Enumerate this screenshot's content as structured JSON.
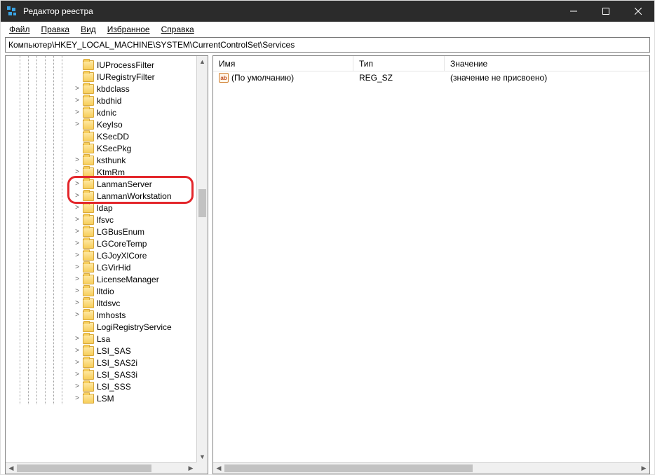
{
  "window": {
    "title": "Редактор реестра"
  },
  "menu": {
    "file": "Файл",
    "edit": "Правка",
    "view": "Вид",
    "favorites": "Избранное",
    "help": "Справка"
  },
  "addressbar": {
    "path": "Компьютер\\HKEY_LOCAL_MACHINE\\SYSTEM\\CurrentControlSet\\Services"
  },
  "tree": {
    "items": [
      {
        "label": "IUProcessFilter",
        "expander": ""
      },
      {
        "label": "IURegistryFilter",
        "expander": ""
      },
      {
        "label": "kbdclass",
        "expander": ">"
      },
      {
        "label": "kbdhid",
        "expander": ">"
      },
      {
        "label": "kdnic",
        "expander": ">"
      },
      {
        "label": "KeyIso",
        "expander": ">"
      },
      {
        "label": "KSecDD",
        "expander": ""
      },
      {
        "label": "KSecPkg",
        "expander": ""
      },
      {
        "label": "ksthunk",
        "expander": ">"
      },
      {
        "label": "KtmRm",
        "expander": ">"
      },
      {
        "label": "LanmanServer",
        "expander": ">"
      },
      {
        "label": "LanmanWorkstation",
        "expander": ">"
      },
      {
        "label": "ldap",
        "expander": ">"
      },
      {
        "label": "lfsvc",
        "expander": ">"
      },
      {
        "label": "LGBusEnum",
        "expander": ">"
      },
      {
        "label": "LGCoreTemp",
        "expander": ">"
      },
      {
        "label": "LGJoyXlCore",
        "expander": ">"
      },
      {
        "label": "LGVirHid",
        "expander": ">"
      },
      {
        "label": "LicenseManager",
        "expander": ">"
      },
      {
        "label": "lltdio",
        "expander": ">"
      },
      {
        "label": "lltdsvc",
        "expander": ">"
      },
      {
        "label": "lmhosts",
        "expander": ">"
      },
      {
        "label": "LogiRegistryService",
        "expander": ""
      },
      {
        "label": "Lsa",
        "expander": ">"
      },
      {
        "label": "LSI_SAS",
        "expander": ">"
      },
      {
        "label": "LSI_SAS2i",
        "expander": ">"
      },
      {
        "label": "LSI_SAS3i",
        "expander": ">"
      },
      {
        "label": "LSI_SSS",
        "expander": ">"
      },
      {
        "label": "LSM",
        "expander": ">"
      }
    ],
    "highlight_indices": [
      10,
      11
    ]
  },
  "list": {
    "columns": {
      "name": "Имя",
      "type": "Тип",
      "value": "Значение"
    },
    "rows": [
      {
        "name": "(По умолчанию)",
        "type": "REG_SZ",
        "value": "(значение не присвоено)"
      }
    ]
  }
}
